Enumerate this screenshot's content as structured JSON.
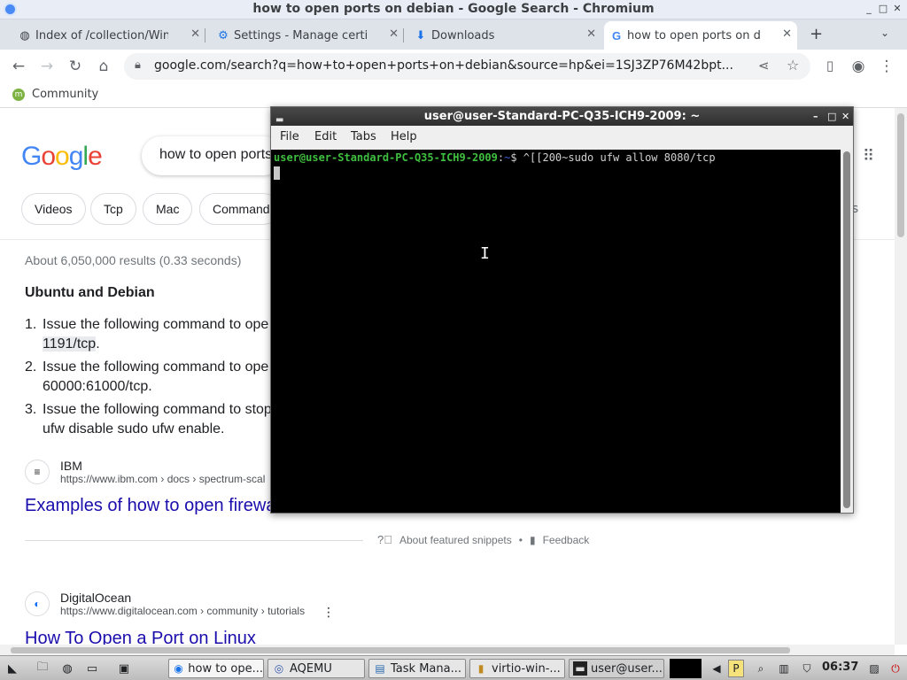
{
  "window": {
    "title": "how to open ports on debian - Google Search - Chromium",
    "controls": [
      "_",
      "□",
      "✕"
    ]
  },
  "tabs": [
    {
      "label": "Index of /collection/Wind",
      "icon": "globe-icon",
      "close": "✕"
    },
    {
      "label": "Settings - Manage certifi",
      "icon": "gear-icon",
      "close": "✕"
    },
    {
      "label": "Downloads",
      "icon": "download-icon",
      "close": "✕"
    },
    {
      "label": "how to open ports on de",
      "icon": "google-icon",
      "close": "✕",
      "active": true
    }
  ],
  "new_tab": "+",
  "address_bar": {
    "url": "google.com/search?q=how+to+open+ports+on+debian&source=hp&ei=1SJ3ZP76M42bpt..."
  },
  "bookmarks": [
    {
      "label": "Community",
      "icon": "mint-icon"
    }
  ],
  "search": {
    "logo": "Google",
    "query": "how to open ports",
    "chips": [
      "Videos",
      "Tcp",
      "Mac",
      "Command"
    ],
    "stats": "About 6,050,000 results (0.33 seconds)",
    "right_partial": "ls"
  },
  "snippet": {
    "title": "Ubuntu and Debian",
    "items": [
      {
        "n": "1.",
        "line1": "Issue the following command to ope",
        "line2": "1191/tcp",
        "line2_suffix": "."
      },
      {
        "n": "2.",
        "line1": "Issue the following command to ope",
        "line2": "60000:61000/tcp."
      },
      {
        "n": "3.",
        "line1": "Issue the following command to stop",
        "line2": "ufw disable sudo ufw enable."
      }
    ]
  },
  "results": [
    {
      "site": "IBM",
      "url": "https://www.ibm.com › docs › spectrum-scal",
      "title": "Examples of how to open firewal"
    },
    {
      "site": "DigitalOcean",
      "url": "https://www.digitalocean.com › community › tutorials",
      "title": "How To Open a Port on Linux",
      "more": "⋮"
    }
  ],
  "snippet_footer": {
    "about": "About featured snippets",
    "sep": "•",
    "feedback": "Feedback"
  },
  "terminal": {
    "title": "user@user-Standard-PC-Q35-ICH9-2009: ~",
    "menu": [
      "File",
      "Edit",
      "Tabs",
      "Help"
    ],
    "prompt_user": "user@user-Standard-PC-Q35-ICH9-2009",
    "prompt_sep": ":",
    "prompt_path": "~",
    "prompt_symbol": "$",
    "command": " ^[[200~sudo ufw allow 8080/tcp",
    "controls": [
      "–",
      "□",
      "✕"
    ]
  },
  "taskbar": {
    "items": [
      {
        "label": "how to ope...",
        "icon": "chromium-icon"
      },
      {
        "label": "AQEMU",
        "icon": "qemu-icon"
      },
      {
        "label": "Task Mana...",
        "icon": "task-manager-icon"
      },
      {
        "label": "virtio-win-...",
        "icon": "folder-icon"
      },
      {
        "label": "user@user...",
        "icon": "terminal-icon"
      }
    ],
    "clock": "06:37"
  },
  "colors": {
    "accent": "#1a73e8",
    "link": "#1a0dab",
    "terminal_green": "#3fbf3f",
    "terminal_blue": "#4060d0"
  }
}
